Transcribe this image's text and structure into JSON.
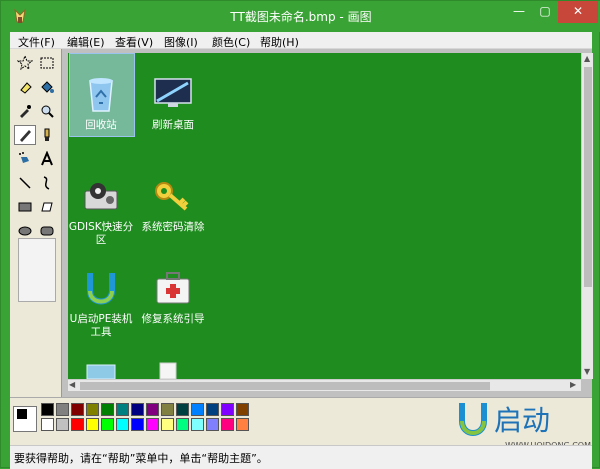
{
  "window": {
    "title": "TT截图未命名.bmp - 画图",
    "min_label": "—",
    "max_label": "▢",
    "close_label": "✕"
  },
  "menu": [
    "文件(F)",
    "编辑(E)",
    "查看(V)",
    "图像(I)",
    "颜色(C)",
    "帮助(H)"
  ],
  "tools": [
    "free-select",
    "rect-select",
    "eraser",
    "fill",
    "pick-color",
    "magnifier",
    "pencil",
    "brush",
    "airbrush",
    "text",
    "line",
    "curve",
    "rectangle",
    "polygon",
    "ellipse",
    "rounded-rect"
  ],
  "desktop": {
    "icons": [
      {
        "label": "回收站"
      },
      {
        "label": "刷新桌面"
      },
      {
        "label": "GDISK快速分区"
      },
      {
        "label": "系统密码清除"
      },
      {
        "label": "U启动PE装机工具"
      },
      {
        "label": "修复系统引导"
      }
    ]
  },
  "palette": {
    "top_row": [
      "#000000",
      "#808080",
      "#800000",
      "#808000",
      "#008000",
      "#008080",
      "#000080",
      "#800080",
      "#808040",
      "#004040",
      "#0080ff",
      "#004080",
      "#8000ff",
      "#804000"
    ],
    "bottom_row": [
      "#ffffff",
      "#c0c0c0",
      "#ff0000",
      "#ffff00",
      "#00ff00",
      "#00ffff",
      "#0000ff",
      "#ff00ff",
      "#ffff80",
      "#00ff80",
      "#80ffff",
      "#8080ff",
      "#ff0080",
      "#ff8040"
    ]
  },
  "status": {
    "text": "要获得帮助，请在“帮助”菜单中，单击“帮助主题”。"
  },
  "watermark": {
    "brand_mark": "U",
    "brand_name": "启动",
    "url": "WWW.UQIDONG.COM"
  },
  "colors": {
    "desktop_green": "#1f8c1f",
    "titlebar_green": "#3aa335"
  }
}
